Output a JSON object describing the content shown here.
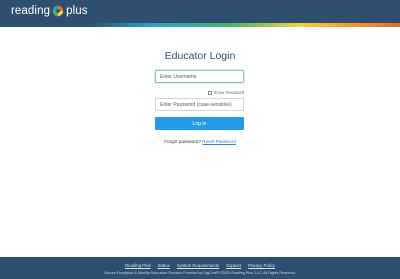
{
  "header": {
    "logo_left": "reading",
    "logo_right": "plus",
    "accent_colors": [
      "#27a3c4",
      "#46b66a",
      "#f2d23a",
      "#f29a2e",
      "#e86a2e"
    ],
    "bar_color": "#2f4f70"
  },
  "login": {
    "title": "Educator Login",
    "username_placeholder": "Enter Username",
    "show_password_label": "Show Password",
    "password_placeholder": "Enter Password (case-sensitive)",
    "login_button": "Log In",
    "forgot_text": "Forgot password?",
    "reset_link": "Reset Password",
    "button_color": "#2399e8"
  },
  "footer": {
    "links": [
      "Reading Plus",
      "Status",
      "System Requirements",
      "Support",
      "Privacy Policy"
    ],
    "copyright": "Secure Encryption & Identity Assurance Services Provided by DigiCert®  ©2021 Reading Plus, LLC. All Rights Reserved."
  }
}
